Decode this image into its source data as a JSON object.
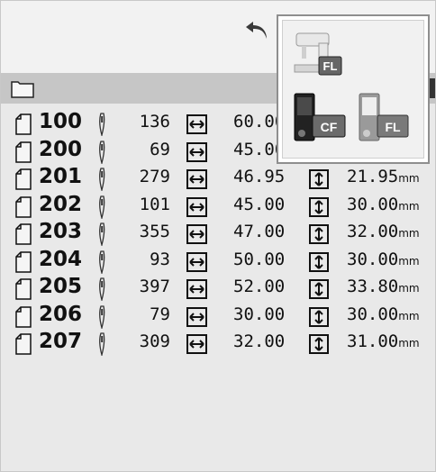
{
  "popup": {
    "machine_badge": "FL",
    "cf_badge": "CF",
    "fl_badge": "FL"
  },
  "units": {
    "mm": "mm"
  },
  "rows": [
    {
      "num": "100",
      "stitches": "136",
      "width": "60.00",
      "height": "",
      "height_unit": ""
    },
    {
      "num": "200",
      "stitches": "69",
      "width": "45.00",
      "height": "",
      "height_unit": ""
    },
    {
      "num": "201",
      "stitches": "279",
      "width": "46.95",
      "height": "21.95",
      "height_unit": "mm"
    },
    {
      "num": "202",
      "stitches": "101",
      "width": "45.00",
      "height": "30.00",
      "height_unit": "mm"
    },
    {
      "num": "203",
      "stitches": "355",
      "width": "47.00",
      "height": "32.00",
      "height_unit": "mm"
    },
    {
      "num": "204",
      "stitches": "93",
      "width": "50.00",
      "height": "30.00",
      "height_unit": "mm"
    },
    {
      "num": "205",
      "stitches": "397",
      "width": "52.00",
      "height": "33.80",
      "height_unit": "mm"
    },
    {
      "num": "206",
      "stitches": "79",
      "width": "30.00",
      "height": "30.00",
      "height_unit": "mm"
    },
    {
      "num": "207",
      "stitches": "309",
      "width": "32.00",
      "height": "31.00",
      "height_unit": "mm"
    }
  ],
  "icons": {
    "undo": "undo-icon",
    "folder": "folder-icon",
    "design": "document-icon",
    "needle": "needle-icon",
    "width": "width-icon",
    "height": "height-icon"
  },
  "colors": {
    "background": "#efefef",
    "folder_bar": "#c6c6c6",
    "popup_border": "#8e8e8e",
    "text": "#111111"
  }
}
